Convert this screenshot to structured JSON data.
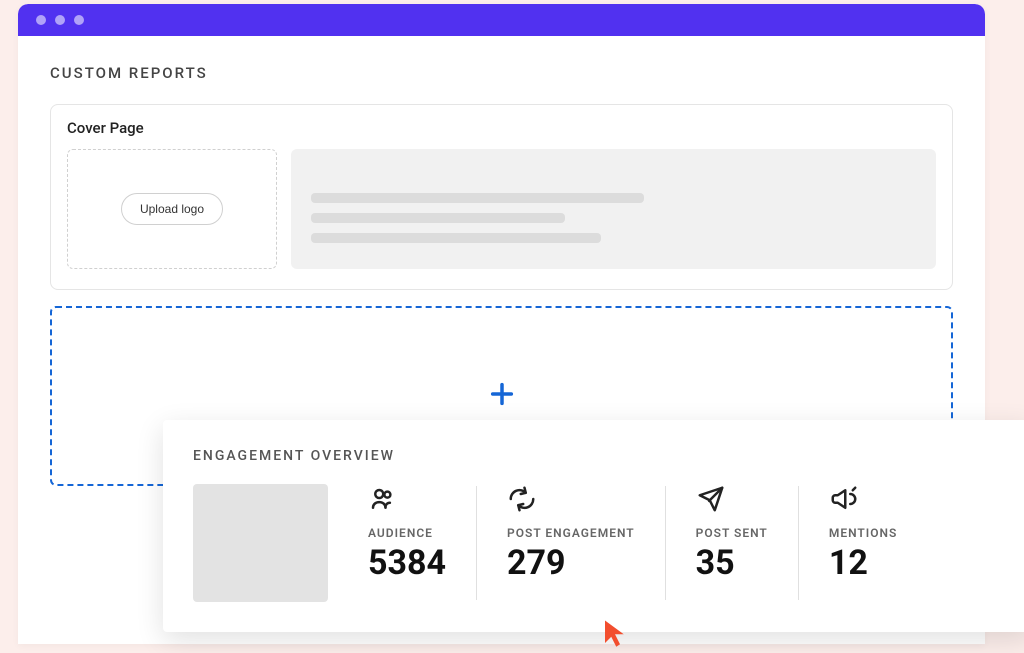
{
  "page": {
    "title": "CUSTOM REPORTS"
  },
  "cover": {
    "title": "Cover Page",
    "upload_label": "Upload logo"
  },
  "overview": {
    "title": "ENGAGEMENT OVERVIEW",
    "metrics": {
      "audience": {
        "label": "AUDIENCE",
        "value": "5384"
      },
      "post_engagement": {
        "label": "POST ENGAGEMENT",
        "value": "279"
      },
      "post_sent": {
        "label": "POST SENT",
        "value": "35"
      },
      "mentions": {
        "label": "MENTIONS",
        "value": "12"
      }
    }
  }
}
